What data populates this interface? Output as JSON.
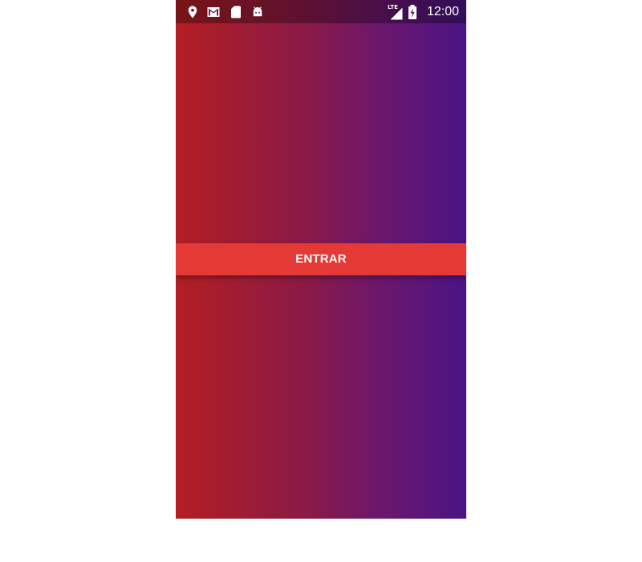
{
  "status_bar": {
    "left_icons": [
      "location-pin-icon",
      "gmail-icon",
      "sd-card-icon",
      "android-icon"
    ],
    "network_label": "LTE",
    "right_icons": [
      "signal-icon",
      "battery-charging-icon"
    ],
    "time": "12:00"
  },
  "main": {
    "enter_button_label": "ENTRAR"
  },
  "colors": {
    "gradient_start": "#b31e22",
    "gradient_end": "#4a1485",
    "button": "#e53935",
    "text": "#ffffff"
  }
}
